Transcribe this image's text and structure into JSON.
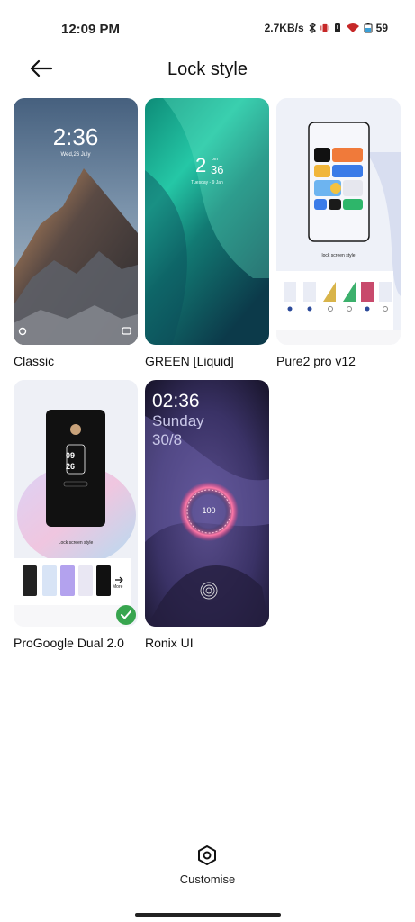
{
  "status_bar": {
    "time": "12:09 PM",
    "network_speed": "2.7KB/s",
    "battery": "59",
    "icons": [
      "bluetooth-icon",
      "vibrate-icon",
      "alarm-icon",
      "wifi-icon",
      "battery-icon"
    ]
  },
  "header": {
    "title": "Lock style",
    "back_icon": "arrow-left-icon"
  },
  "styles": [
    {
      "label": "Classic",
      "time": "2:36",
      "date": "Wed,26 July"
    },
    {
      "label": "GREEN [Liquid]",
      "hour": "2",
      "ampm": "pm",
      "minute": "36",
      "date": "Tuesday - 9 Jan"
    },
    {
      "label": "Pure2 pro v12",
      "caption": "lock screen style"
    },
    {
      "label": "ProGoogle Dual 2.0",
      "hour": "09",
      "minute": "26",
      "caption": "Lock screen style",
      "more": "More",
      "selected": true
    },
    {
      "label": "Ronix UI",
      "time": "02:36",
      "day": "Sunday",
      "date": "30/8",
      "percent": "100"
    }
  ],
  "customise": {
    "label": "Customise",
    "icon": "hexagon-gear-icon"
  },
  "colors": {
    "accent_check": "#38a54f",
    "classic_sky": "#6e8aa8",
    "green_aurora": "#1fb89b",
    "ronix_bg": "#2a2440"
  }
}
